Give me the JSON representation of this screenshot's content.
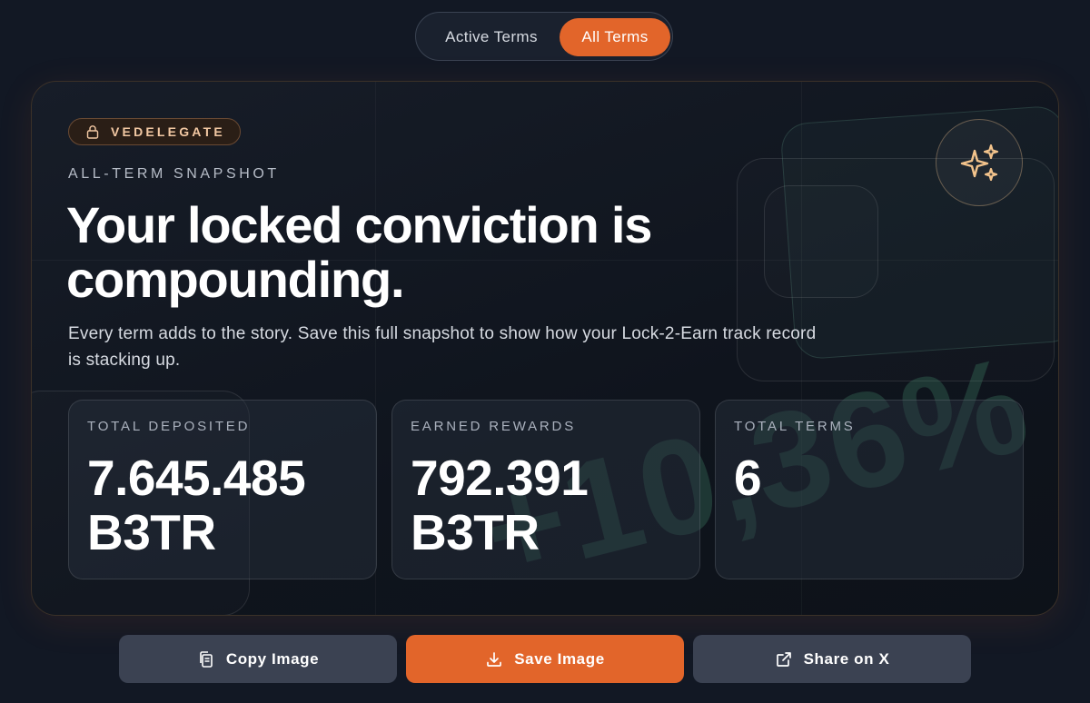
{
  "toggle": {
    "active_terms_label": "Active Terms",
    "all_terms_label": "All Terms",
    "selected": "All Terms"
  },
  "card": {
    "badge_label": "VEDELEGATE",
    "eyebrow": "ALL-TERM SNAPSHOT",
    "headline": "Your locked conviction is compounding.",
    "subtext": "Every term adds to the story. Save this full snapshot to show how your Lock-2-Earn track record is stacking up.",
    "watermark_percent": "+10,36%",
    "stats": [
      {
        "label": "TOTAL DEPOSITED",
        "value": "7.645.485 B3TR"
      },
      {
        "label": "EARNED REWARDS",
        "value": "792.391 B3TR"
      },
      {
        "label": "TOTAL TERMS",
        "value": "6"
      }
    ]
  },
  "actions": {
    "copy_label": "Copy Image",
    "save_label": "Save Image",
    "share_label": "Share on X"
  },
  "colors": {
    "accent": "#e2652a",
    "background": "#121824",
    "button_secondary": "#3b4252",
    "badge_text": "#f2c8a3",
    "watermark": "#468c6e"
  },
  "icons": [
    "lock-icon",
    "sparkles-icon",
    "copy-icon",
    "download-icon",
    "external-link-icon"
  ]
}
